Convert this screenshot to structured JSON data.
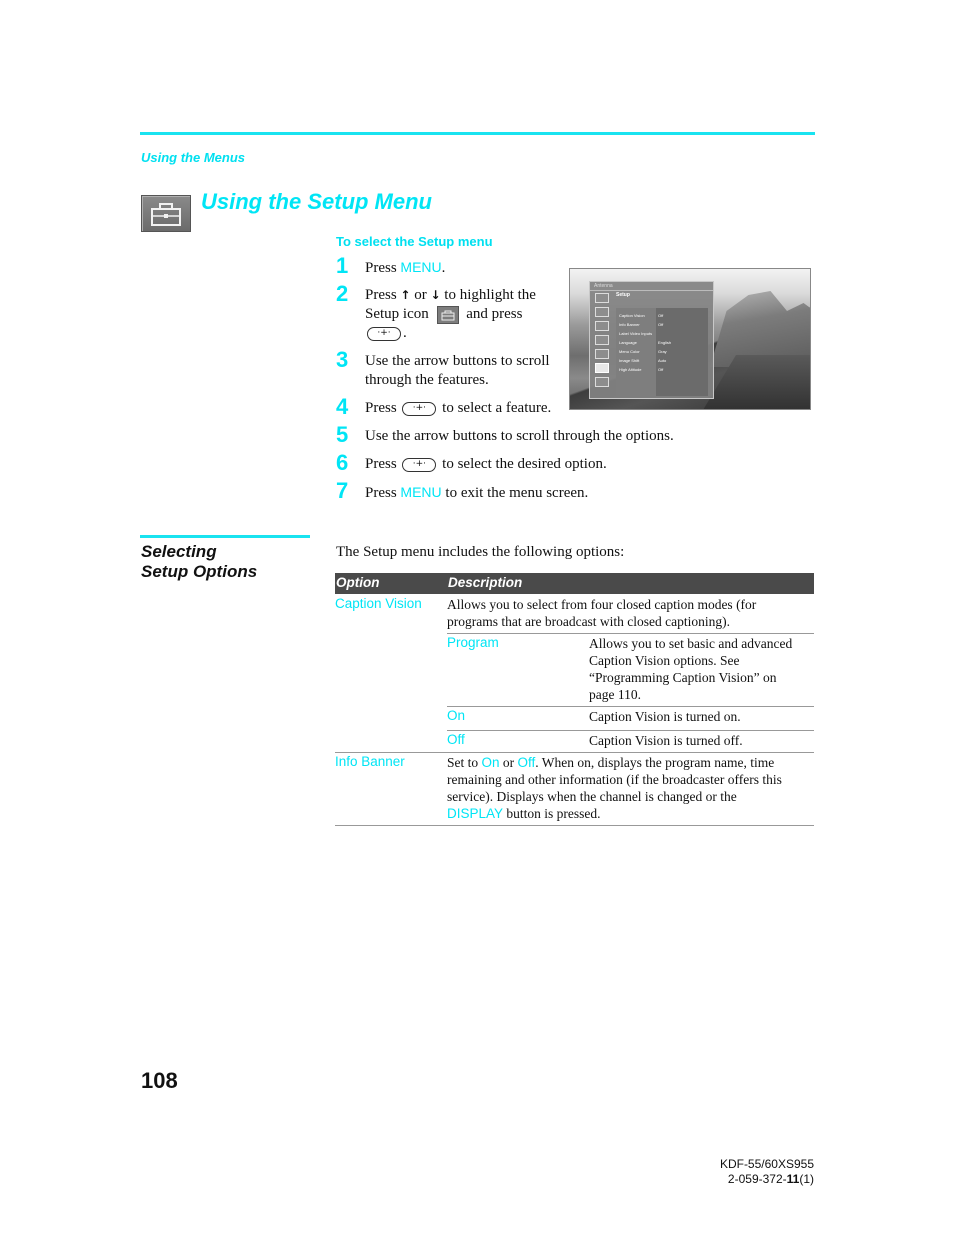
{
  "header": {
    "section_label": "Using the Menus",
    "page_title": "Using the Setup Menu",
    "title_icon": "toolbox-icon"
  },
  "procedure": {
    "heading": "To select the Setup menu",
    "steps": [
      {
        "num": "1",
        "parts": {
          "a": "Press ",
          "key": "MENU",
          "b": "."
        }
      },
      {
        "num": "2",
        "parts": {
          "a": "Press ",
          "up": "↑",
          "or": " or ",
          "down": "↓",
          "b": " to highlight the",
          "c": "Setup icon",
          "d": "and press",
          "e": "."
        }
      },
      {
        "num": "3",
        "parts": {
          "a": "Use the arrow buttons to scroll",
          "b": "through the features."
        }
      },
      {
        "num": "4",
        "parts": {
          "a": "Press",
          "b": "to select a feature."
        }
      },
      {
        "num": "5",
        "parts": {
          "a": "Use the arrow buttons to scroll through the options."
        }
      },
      {
        "num": "6",
        "parts": {
          "a": "Press",
          "b": "to select the desired option."
        }
      },
      {
        "num": "7",
        "parts": {
          "a": "Press ",
          "key": "MENU",
          "b": " to exit the menu screen."
        }
      }
    ]
  },
  "tv_screen": {
    "header": "Antenna",
    "menu_title": "Setup",
    "items": [
      {
        "label": "Caption Vision",
        "value": "Off"
      },
      {
        "label": "Info Banner",
        "value": "Off"
      },
      {
        "label": "Label Video Inputs",
        "value": ""
      },
      {
        "label": "Language",
        "value": "English"
      },
      {
        "label": "Menu Color",
        "value": "Gray"
      },
      {
        "label": "Image Shift",
        "value": "Auto"
      },
      {
        "label": "High Altitude",
        "value": "Off"
      }
    ]
  },
  "selecting": {
    "heading_line1": "Selecting",
    "heading_line2": "Setup Options",
    "intro": "The Setup menu includes the following options:",
    "table": {
      "col_option": "Option",
      "col_description": "Description",
      "rows": [
        {
          "option": "Caption Vision",
          "description": [
            "Allows you to select from four closed caption modes (for",
            "programs that are broadcast with closed captioning)."
          ],
          "sub": [
            {
              "option": "Program",
              "description": [
                "Allows you to set basic and advanced",
                "Caption Vision options. See",
                "“Programming Caption Vision” on",
                "page 110."
              ]
            },
            {
              "option": "On",
              "description": [
                "Caption Vision is turned on."
              ]
            },
            {
              "option": "Off",
              "description": [
                "Caption Vision is turned off."
              ]
            }
          ]
        },
        {
          "option": "Info Banner",
          "description": {
            "a": "Set to ",
            "on": "On",
            "or": " or ",
            "off": "Off",
            "b": ". When on, displays the program name, time",
            "l2": "remaining and other information (if the broadcaster offers this",
            "l3": "service). Displays when the channel is changed or the",
            "display": "DISPLAY",
            "l4": " button is pressed."
          }
        }
      ]
    }
  },
  "footer": {
    "page_number": "108",
    "model": "KDF-55/60XS955",
    "code_prefix": "2-059-372-",
    "code_bold": "11",
    "code_suffix": "(1)"
  }
}
